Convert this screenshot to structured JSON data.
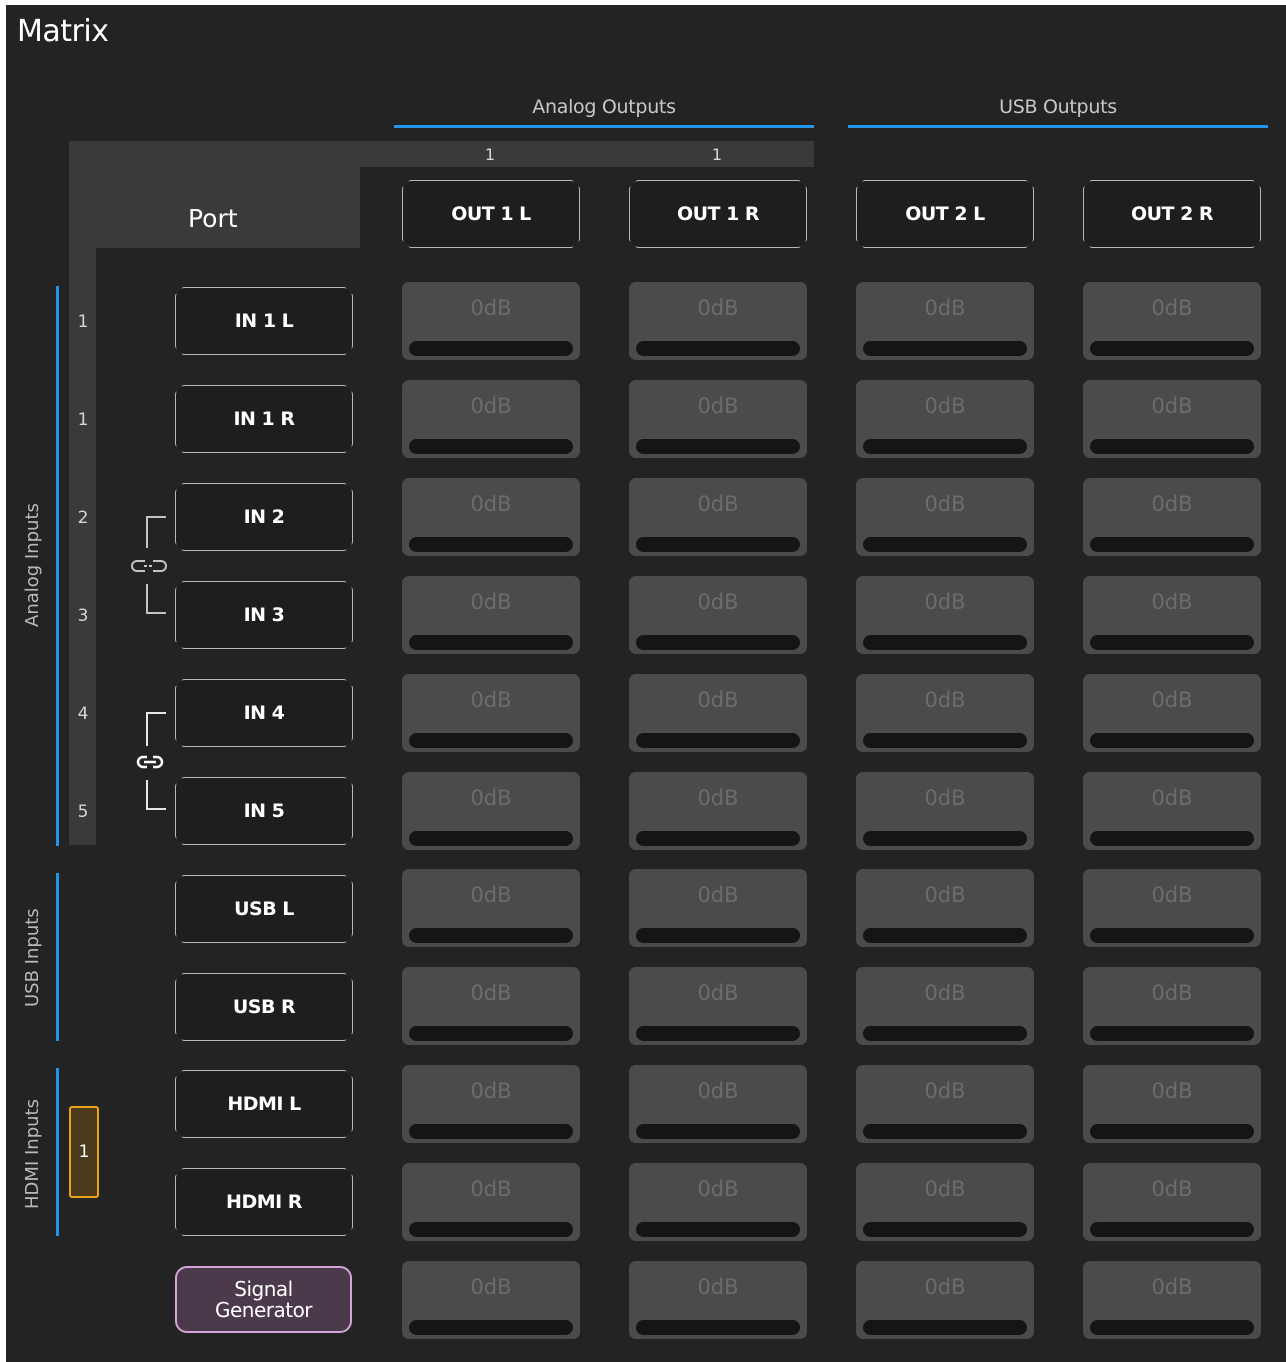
{
  "title": "Matrix",
  "groups": {
    "analog_outputs": "Analog Outputs",
    "usb_outputs": "USB Outputs",
    "analog_inputs": "Analog Inputs",
    "usb_inputs": "USB Inputs",
    "hdmi_inputs": "HDMI Inputs"
  },
  "port_header": "Port",
  "output_numbers": [
    "1",
    "1"
  ],
  "outputs": [
    "OUT 1 L",
    "OUT 1 R",
    "OUT 2 L",
    "OUT 2 R"
  ],
  "inputs": [
    {
      "label": "IN 1 L",
      "index": "1"
    },
    {
      "label": "IN 1 R",
      "index": "1"
    },
    {
      "label": "IN 2",
      "index": "2"
    },
    {
      "label": "IN 3",
      "index": "3"
    },
    {
      "label": "IN 4",
      "index": "4"
    },
    {
      "label": "IN 5",
      "index": "5"
    },
    {
      "label": "USB L",
      "index": ""
    },
    {
      "label": "USB R",
      "index": ""
    },
    {
      "label": "HDMI L",
      "index": ""
    },
    {
      "label": "HDMI R",
      "index": ""
    },
    {
      "label": "Signal Generator",
      "index": ""
    }
  ],
  "hdmi_index": "1",
  "cell_value": "0dB",
  "colors": {
    "accent": "#2196e8",
    "hdmi_selected": "#e8a317",
    "signal_generator_border": "#d5a4d8"
  },
  "icons": {
    "link_unlinked": "broken-link-icon",
    "link_linked": "link-icon"
  }
}
